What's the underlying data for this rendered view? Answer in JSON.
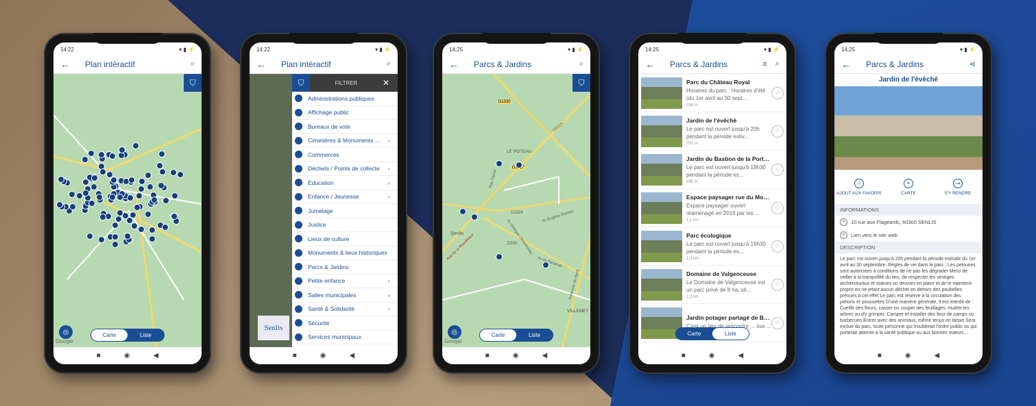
{
  "status_times": [
    "14:22",
    "14:22",
    "14:25",
    "14:25",
    "14:25"
  ],
  "phone1": {
    "title": "Plan intéractif",
    "toggle": {
      "map": "Carte",
      "list": "Liste",
      "active": "map"
    },
    "google": "Google"
  },
  "phone2": {
    "title": "Plan intéractif",
    "filter_label": "FILTRER",
    "map_label": "Senlis",
    "items": [
      {
        "label": "Administrations publiques",
        "sub": false
      },
      {
        "label": "Affichage public",
        "sub": false
      },
      {
        "label": "Bureaux de vote",
        "sub": false
      },
      {
        "label": "Cimetières & Monuments ...",
        "sub": true
      },
      {
        "label": "Commerces",
        "sub": false
      },
      {
        "label": "Déchets / Points de collecte",
        "sub": true
      },
      {
        "label": "Éducation",
        "sub": true
      },
      {
        "label": "Enfance / Jeunesse",
        "sub": true
      },
      {
        "label": "Jumelage",
        "sub": false
      },
      {
        "label": "Justice",
        "sub": false
      },
      {
        "label": "Lieux de culture",
        "sub": false
      },
      {
        "label": "Monuments & lieux historiques",
        "sub": false
      },
      {
        "label": "Parcs & Jardins",
        "sub": false
      },
      {
        "label": "Petite enfance",
        "sub": true
      },
      {
        "label": "Salles municipales",
        "sub": true
      },
      {
        "label": "Santé & Solidarité",
        "sub": true
      },
      {
        "label": "Sécurité",
        "sub": false
      },
      {
        "label": "Services municipaux",
        "sub": false
      }
    ]
  },
  "phone3": {
    "title": "Parcs & Jardins",
    "toggle": {
      "map": "Carte",
      "list": "Liste",
      "active": "map"
    },
    "google": "Google",
    "map_labels": [
      "D1330",
      "D932A",
      "LE POTEAU",
      "D1017",
      "D1324",
      "D330",
      "Senlis",
      "VILLEMET",
      "Rue de la République",
      "Av Georges Clemenceau",
      "Av du Parseval",
      "Av Eugène Gazeau",
      "Rue Carnot",
      "Autoroute du Nord"
    ]
  },
  "phone4": {
    "title": "Parcs & Jardins",
    "toggle": {
      "map": "Carte",
      "list": "Liste",
      "active": "list"
    },
    "items": [
      {
        "name": "Parc du Château Royal",
        "desc": "Horaires du parc : Horaires d'été (du 1er avril au 30 sept...",
        "dist": "238 m"
      },
      {
        "name": "Jardin de l'évêché",
        "desc": "Le parc est ouvert jusqu'à 20h pendant la période estiv...",
        "dist": "292 m"
      },
      {
        "name": "Jardin du Bastion de la Porte de ...",
        "desc": "Le parc est ouvert jusqu'à 19h30 pendant la période es...",
        "dist": "695 m"
      },
      {
        "name": "Espace paysager rue du Moulin ...",
        "desc": "Espace paysager ouvert réaménagé en 2019 par les ...",
        "dist": "1,1 km"
      },
      {
        "name": "Parc écologique",
        "desc": "Le parc est ouvert jusqu'à 19h30 pendant la période es...",
        "dist": "1,3 km"
      },
      {
        "name": "Domaine de Valgenceuse",
        "desc": "Le Domaine de Valgenceuse est un parc privé de 8 ha, sit...",
        "dist": "1,3 km"
      },
      {
        "name": "Jardin potager partagé de Brich...",
        "desc": "C'est un lieu de rencontre ... ous ...",
        "dist": ""
      }
    ]
  },
  "phone5": {
    "title": "Parcs & Jardins",
    "place": "Jardin de l'évêché",
    "actions": [
      "AJOUT AUX FAVORIS",
      "CARTE",
      "S'Y RENDRE"
    ],
    "info_header": "INFORMATIONS",
    "address": "10 rue aux Flageards, 60300 SENLIS",
    "website": "Lien vers le site web",
    "desc_header": "DESCRIPTION",
    "description": "Le parc est ouvert jusqu'à 20h pendant la période estivale du 1er avril au 30 septembre. Règles de vie dans le parc : Les pelouses sont autorisées à conditions de ne pas les dégrader Merci de veiller à la tranquillité du lieu, de respecter les vestiges architecturaux et statues ou œuvres en place et de le maintenir propre en ne jetant aucun déchet en dehors des poubelles prévues à cet effet Le parc est réservé à la circulation des piétons et poussettes D'une manière générale, il est interdit de : Cueillir des fleurs, casser ou couper des feuillages, mutiler les arbres ou d'y grimper. Camper et installer des feux de camps ou barbecues Entrer avec des animaux, même tenus en laisse Sera exclue du parc, toute personne qui troublerait l'ordre public ou qui porterait atteinte à la santé publique ou aux bonnes mœurs..."
  },
  "colors": {
    "primary": "#1a4e94",
    "map_green": "#b7d9b1",
    "road_yellow": "#f3d86b"
  }
}
